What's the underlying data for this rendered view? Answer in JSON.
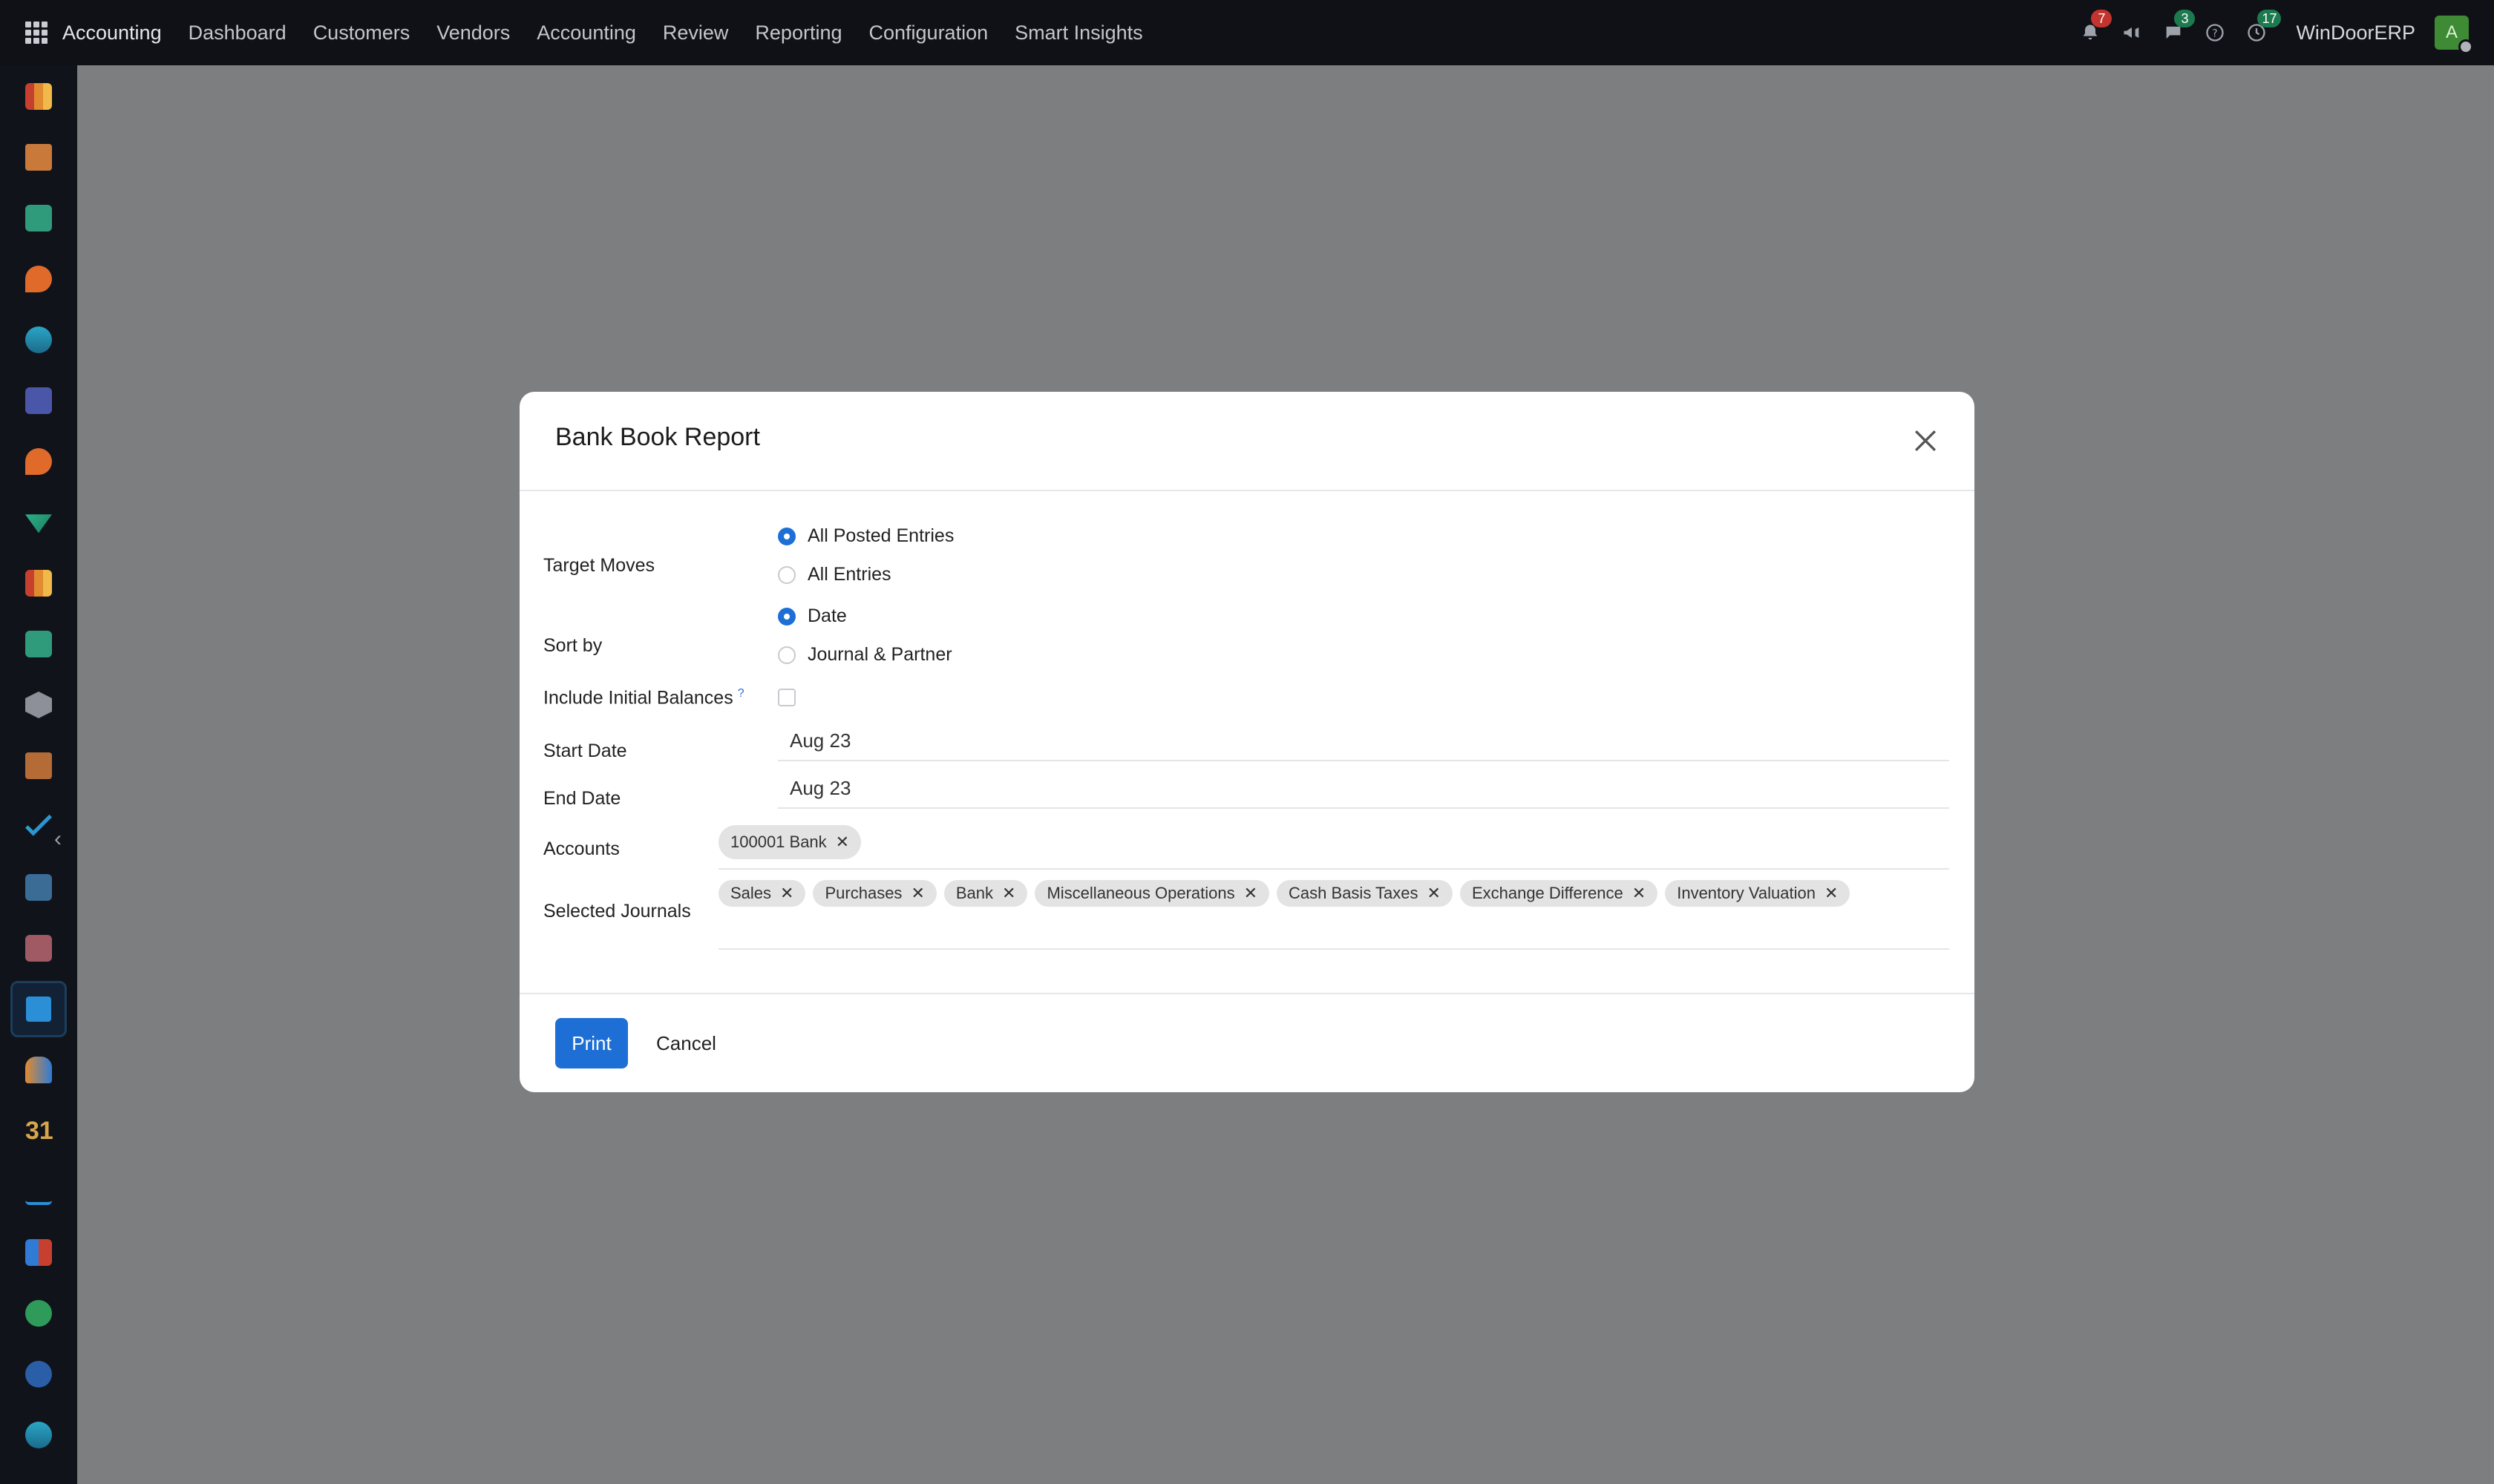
{
  "navbar": {
    "brand": "Accounting",
    "items": [
      "Dashboard",
      "Customers",
      "Vendors",
      "Accounting",
      "Review",
      "Reporting",
      "Configuration",
      "Smart Insights"
    ],
    "notifications_badge": "7",
    "messages_badge": "3",
    "activities_badge": "17",
    "company": "WinDoorERP",
    "avatar_letter": "A"
  },
  "modal": {
    "title": "Bank Book Report",
    "fields": {
      "target_moves_label": "Target Moves",
      "target_moves_options": [
        "All Posted Entries",
        "All Entries"
      ],
      "target_moves_selected": "All Posted Entries",
      "sort_by_label": "Sort by",
      "sort_by_options": [
        "Date",
        "Journal & Partner"
      ],
      "sort_by_selected": "Date",
      "initial_balances_label": "Include Initial Balances",
      "initial_balances_help": "?",
      "initial_balances_checked": false,
      "start_date_label": "Start Date",
      "start_date_value": "Aug 23",
      "end_date_label": "End Date",
      "end_date_value": "Aug 23",
      "accounts_label": "Accounts",
      "accounts": [
        "100001 Bank"
      ],
      "journals_label": "Selected Journals",
      "journals": [
        "Sales",
        "Purchases",
        "Bank",
        "Miscellaneous Operations",
        "Cash Basis Taxes",
        "Exchange Difference",
        "Inventory Valuation"
      ]
    },
    "footer": {
      "print_label": "Print",
      "cancel_label": "Cancel"
    }
  },
  "colors": {
    "primary": "#1d6fd6",
    "navbar_bg": "#0f1117",
    "overlay_bg": "#7d7e80",
    "tag_bg": "#e3e3e4"
  },
  "sidebar": {
    "icons": [
      "bar-chart-icon",
      "puzzle-icon",
      "contacts-icon",
      "chat-bubble-icon",
      "globe-icon",
      "mail-icon",
      "chat-bubble-icon",
      "check-arrow-icon",
      "bar-chart-icon",
      "contacts-icon",
      "cube-icon",
      "puzzle-icon",
      "check-icon",
      "inbox-icon",
      "box-icon",
      "accounting-icon",
      "team-icon",
      "calendar-icon",
      "sign-icon",
      "dashboard-icon",
      "whatsapp-icon",
      "compass-icon",
      "globe-icon"
    ]
  }
}
